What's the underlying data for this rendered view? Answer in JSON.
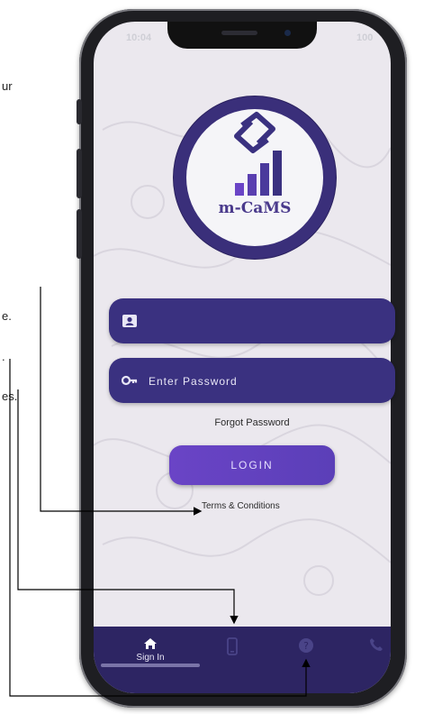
{
  "annotations": {
    "line1": "ur",
    "line2": "e.",
    "line3": ".",
    "line4": "es."
  },
  "status_bar": {
    "time": "10:04",
    "battery": "100"
  },
  "logo": {
    "text": "m-CaMS"
  },
  "login_form": {
    "username": {
      "value": "",
      "placeholder": ""
    },
    "password": {
      "value": "",
      "placeholder": "Enter Password"
    },
    "forgot_label": "Forgot Password",
    "login_label": "LOGIN",
    "terms_label": "Terms & Conditions"
  },
  "bottom_nav": {
    "items": [
      {
        "label": "Sign In",
        "icon": "home-icon",
        "active": true
      },
      {
        "label": "",
        "icon": "phone-device-icon",
        "active": false
      },
      {
        "label": "",
        "icon": "help-icon",
        "active": false
      },
      {
        "label": "",
        "icon": "call-icon",
        "active": false
      }
    ]
  },
  "colors": {
    "brand": "#3a3180",
    "nav_bg": "#2d2563",
    "button": "#6a44c6",
    "logo_ring": "#3a2f7a"
  }
}
